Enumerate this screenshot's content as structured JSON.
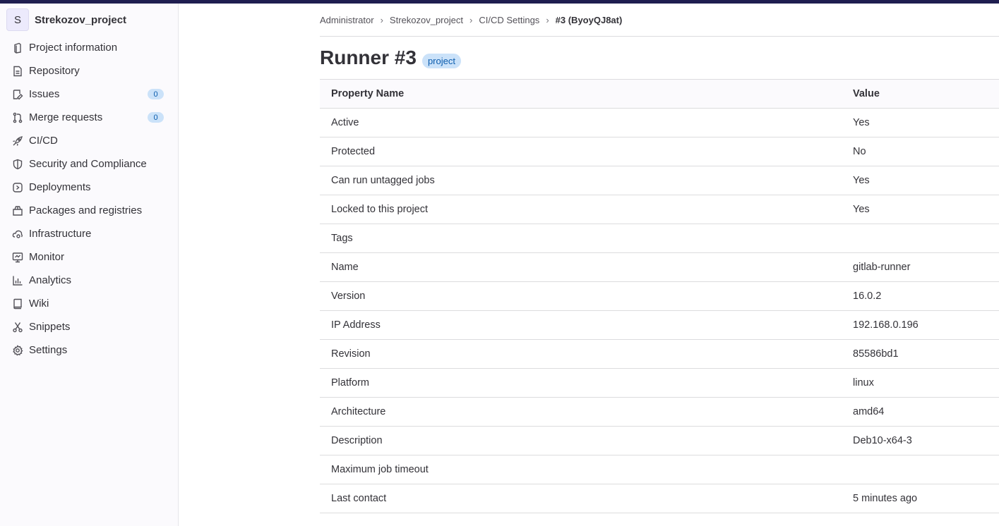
{
  "sidebar": {
    "avatar_letter": "S",
    "project_name": "Strekozov_project",
    "items": [
      {
        "label": "Project information",
        "icon": "project-info-icon"
      },
      {
        "label": "Repository",
        "icon": "document-icon"
      },
      {
        "label": "Issues",
        "icon": "issues-icon",
        "badge": "0"
      },
      {
        "label": "Merge requests",
        "icon": "merge-request-icon",
        "badge": "0"
      },
      {
        "label": "CI/CD",
        "icon": "rocket-icon"
      },
      {
        "label": "Security and Compliance",
        "icon": "shield-icon"
      },
      {
        "label": "Deployments",
        "icon": "deployments-icon"
      },
      {
        "label": "Packages and registries",
        "icon": "package-icon"
      },
      {
        "label": "Infrastructure",
        "icon": "cloud-gear-icon"
      },
      {
        "label": "Monitor",
        "icon": "monitor-icon"
      },
      {
        "label": "Analytics",
        "icon": "chart-icon"
      },
      {
        "label": "Wiki",
        "icon": "book-icon"
      },
      {
        "label": "Snippets",
        "icon": "scissors-icon"
      },
      {
        "label": "Settings",
        "icon": "gear-icon"
      }
    ]
  },
  "breadcrumb": [
    "Administrator",
    "Strekozov_project",
    "CI/CD Settings",
    "#3 (ByoyQJ8at)"
  ],
  "page": {
    "title": "Runner #3",
    "badge": "project"
  },
  "table": {
    "headers": [
      "Property Name",
      "Value"
    ],
    "rows": [
      [
        "Active",
        "Yes"
      ],
      [
        "Protected",
        "No"
      ],
      [
        "Can run untagged jobs",
        "Yes"
      ],
      [
        "Locked to this project",
        "Yes"
      ],
      [
        "Tags",
        ""
      ],
      [
        "Name",
        "gitlab-runner"
      ],
      [
        "Version",
        "16.0.2"
      ],
      [
        "IP Address",
        "192.168.0.196"
      ],
      [
        "Revision",
        "85586bd1"
      ],
      [
        "Platform",
        "linux"
      ],
      [
        "Architecture",
        "amd64"
      ],
      [
        "Description",
        "Deb10-x64-3"
      ],
      [
        "Maximum job timeout",
        ""
      ],
      [
        "Last contact",
        "5 minutes ago"
      ]
    ]
  },
  "colors": {
    "topbar": "#1f1e50",
    "badge_bg": "#cbe2f9",
    "badge_text": "#0b5cad"
  }
}
